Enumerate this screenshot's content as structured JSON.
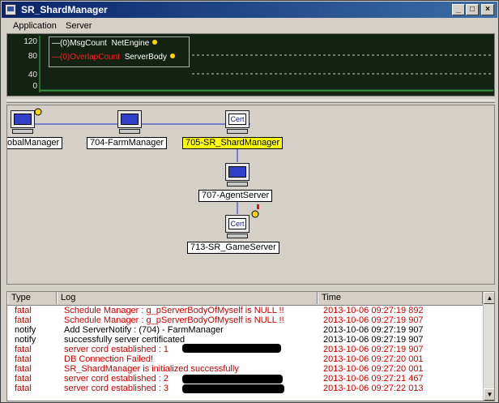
{
  "window": {
    "title": "SR_ShardManager",
    "controls": {
      "minimize": "_",
      "maximize": "□",
      "close": "×"
    }
  },
  "menu": {
    "items": [
      "Application",
      "Server"
    ]
  },
  "chart_data": {
    "type": "line",
    "y_ticks": [
      "120",
      "80",
      "40",
      "0"
    ],
    "ylim": [
      0,
      120
    ],
    "series": [
      {
        "name": "(0)MsgCount",
        "source": "NetEngine",
        "color": "#ffffff",
        "values": [
          0
        ]
      },
      {
        "name": "(0)OverlapCount",
        "source": "ServerBody",
        "color": "#ff2020",
        "values": [
          0
        ]
      }
    ],
    "grid": true,
    "legend": "top-left",
    "colors": {
      "background": "#142214",
      "baseline": "#3cb44b",
      "grid": "#c8c8c8",
      "marker": "#ffd700"
    }
  },
  "diagram": {
    "nodes": [
      {
        "id": "global",
        "label": "obalManager",
        "icon": "computer-icon",
        "selected": false
      },
      {
        "id": "farm",
        "label": "704-FarmManager",
        "icon": "computer-icon",
        "selected": false
      },
      {
        "id": "shard",
        "label": "705-SR_ShardManager",
        "icon": "cert-computer-icon",
        "screen_text": "Cert",
        "selected": true
      },
      {
        "id": "agent",
        "label": "707-AgentServer",
        "icon": "computer-icon",
        "selected": false
      },
      {
        "id": "game",
        "label": "713-SR_GameServer",
        "icon": "cert-computer-icon",
        "screen_text": "Cert",
        "selected": false
      }
    ],
    "colors": {
      "link": "#1c2ecc",
      "selected": "#ffff00"
    }
  },
  "log": {
    "columns": [
      "Type",
      "Log",
      "Time"
    ],
    "rows": [
      {
        "type": "fatal",
        "log": "Schedule Manager : g_pServerBodyOfMyself is NULL !!",
        "time": "2013-10-06 09:27:19 892",
        "level": "fatal"
      },
      {
        "type": "fatal",
        "log": "Schedule Manager : g_pServerBodyOfMyself is NULL !!",
        "time": "2013-10-06 09:27:19 907",
        "level": "fatal"
      },
      {
        "type": "notify",
        "log": "Add ServerNotify : (704) - FarmManager",
        "time": "2013-10-06 09:27:19 907",
        "level": "notify"
      },
      {
        "type": "notify",
        "log": "successfully server certificated",
        "time": "2013-10-06 09:27:19 907",
        "level": "notify"
      },
      {
        "type": "fatal",
        "log": "server cord established : 1",
        "time": "2013-10-06 09:27:19 907",
        "level": "fatal"
      },
      {
        "type": "fatal",
        "log": "DB Connection Failed!",
        "time": "2013-10-06 09:27:20 001",
        "level": "fatal"
      },
      {
        "type": "fatal",
        "log": "SR_ShardManager is initialized successfully",
        "time": "2013-10-06 09:27:20 001",
        "level": "fatal"
      },
      {
        "type": "fatal",
        "log": "server cord established : 2",
        "time": "2013-10-06 09:27:21 467",
        "level": "fatal"
      },
      {
        "type": "fatal",
        "log": "server cord established : 3",
        "time": "2013-10-06 09:27:22 013",
        "level": "fatal"
      }
    ],
    "colors": {
      "fatal": "#cc0000",
      "notify": "#000000"
    }
  }
}
